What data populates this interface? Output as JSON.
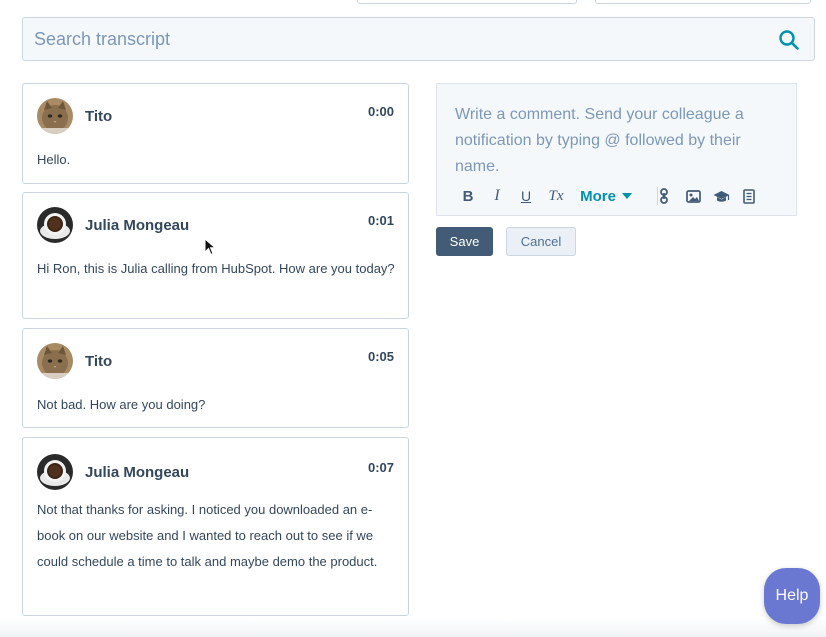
{
  "search": {
    "placeholder": "Search transcript",
    "icon": "search-icon"
  },
  "transcript": [
    {
      "speaker": "Tito",
      "time": "0:00",
      "text": "Hello.",
      "avatar": "cat-avatar"
    },
    {
      "speaker": "Julia Mongeau",
      "time": "0:01",
      "text": "Hi Ron, this is Julia calling from HubSpot. How are you today?",
      "avatar": "coffee-avatar"
    },
    {
      "speaker": "Tito",
      "time": "0:05",
      "text": "Not bad. How are you doing?",
      "avatar": "cat-avatar"
    },
    {
      "speaker": "Julia Mongeau",
      "time": "0:07",
      "text": "Not that thanks for asking. I noticed you downloaded an e-book on our website and I wanted to reach out to see if we could schedule a time to talk and maybe demo the product.",
      "avatar": "coffee-avatar"
    }
  ],
  "comment": {
    "placeholder": "Write a comment. Send your colleague a notification by typing @ followed by their name.",
    "toolbar": {
      "bold": "B",
      "italic": "I",
      "underline": "U",
      "clear": "Tx",
      "more": "More"
    },
    "save_label": "Save",
    "cancel_label": "Cancel"
  },
  "help_label": "Help",
  "colors": {
    "accent": "#0091ae",
    "primary_button": "#425b76",
    "help": "#6a78d1",
    "text": "#33475b",
    "placeholder": "#7c98b6"
  }
}
